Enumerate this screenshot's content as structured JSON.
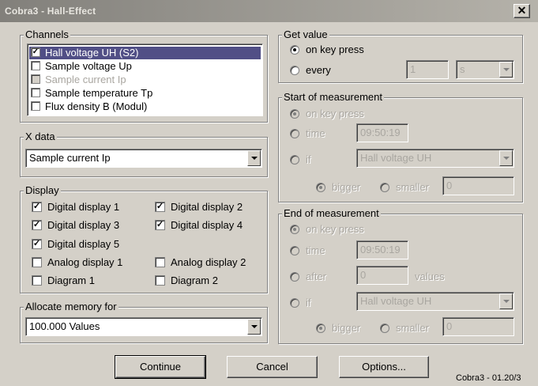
{
  "window": {
    "title": "Cobra3 - Hall-Effect",
    "close_glyph": "✕"
  },
  "channels": {
    "legend": "Channels",
    "items": [
      {
        "label": "Hall voltage UH   (S2)",
        "checked": true,
        "selected": true,
        "disabled": false
      },
      {
        "label": "Sample voltage Up",
        "checked": false,
        "selected": false,
        "disabled": false
      },
      {
        "label": "Sample current Ip",
        "checked": false,
        "selected": false,
        "disabled": true
      },
      {
        "label": "Sample temperature Tp",
        "checked": false,
        "selected": false,
        "disabled": false
      },
      {
        "label": "Flux density B   (Modul)",
        "checked": false,
        "selected": false,
        "disabled": false
      }
    ]
  },
  "xdata": {
    "legend": "X data",
    "value": "Sample current Ip"
  },
  "display": {
    "legend": "Display",
    "items": [
      {
        "label": "Digital display  1",
        "checked": true
      },
      {
        "label": "Digital display  2",
        "checked": true
      },
      {
        "label": "Digital display  3",
        "checked": true
      },
      {
        "label": "Digital display  4",
        "checked": true
      },
      {
        "label": "Digital display  5",
        "checked": true
      },
      {
        "label": "Analog display 1",
        "checked": false
      },
      {
        "label": "Analog display 2",
        "checked": false
      },
      {
        "label": "Diagram 1",
        "checked": false
      },
      {
        "label": "Diagram 2",
        "checked": false
      }
    ]
  },
  "memory": {
    "legend": "Allocate memory for",
    "value": "100.000 Values"
  },
  "get_value": {
    "legend": "Get value",
    "on_key_press": "on key press",
    "every": "every",
    "every_value": "1",
    "every_unit": "s"
  },
  "start": {
    "legend": "Start of measurement",
    "on_key_press": "on key press",
    "time_label": "time",
    "time_value": "09:50:19",
    "if_label": "if",
    "if_value": "Hall voltage UH",
    "bigger": "bigger",
    "smaller": "smaller",
    "threshold": "0"
  },
  "end": {
    "legend": "End of measurement",
    "on_key_press": "on key press",
    "time_label": "time",
    "time_value": "09:50:19",
    "after_label": "after",
    "after_value": "0",
    "values_label": "values",
    "if_label": "if",
    "if_value": "Hall voltage UH",
    "bigger": "bigger",
    "smaller": "smaller",
    "threshold": "0"
  },
  "buttons": {
    "continue": "Continue",
    "cancel": "Cancel",
    "options": "Options..."
  },
  "status": "Cobra3 - 01.20/3"
}
